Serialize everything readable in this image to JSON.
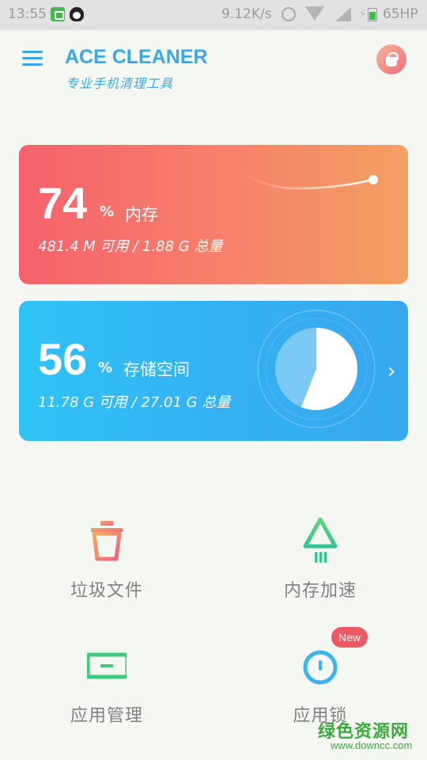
{
  "status_bar": {
    "time": "13:55",
    "network_speed": "9.12K/s",
    "battery": "65HP"
  },
  "header": {
    "title": "ACE CLEANER",
    "subtitle": "专业手机清理工具"
  },
  "memory_card": {
    "percent": "74",
    "percent_sign": "%",
    "label": "内存",
    "detail": "481.4 M 可用 / 1.88 G 总量",
    "accent": "#f5626d"
  },
  "storage_card": {
    "percent": "56",
    "percent_sign": "%",
    "label": "存储空间",
    "detail": "11.78 G 可用 / 27.01 G 总量",
    "accent": "#2fc3f5",
    "used_fraction": 0.56
  },
  "tools": {
    "junk_files": "垃圾文件",
    "memory_boost": "内存加速",
    "app_manager": "应用管理",
    "app_lock": "应用锁",
    "new_badge": "New"
  },
  "watermark": {
    "text": "绿色资源网",
    "url": "www.downcc.com"
  }
}
